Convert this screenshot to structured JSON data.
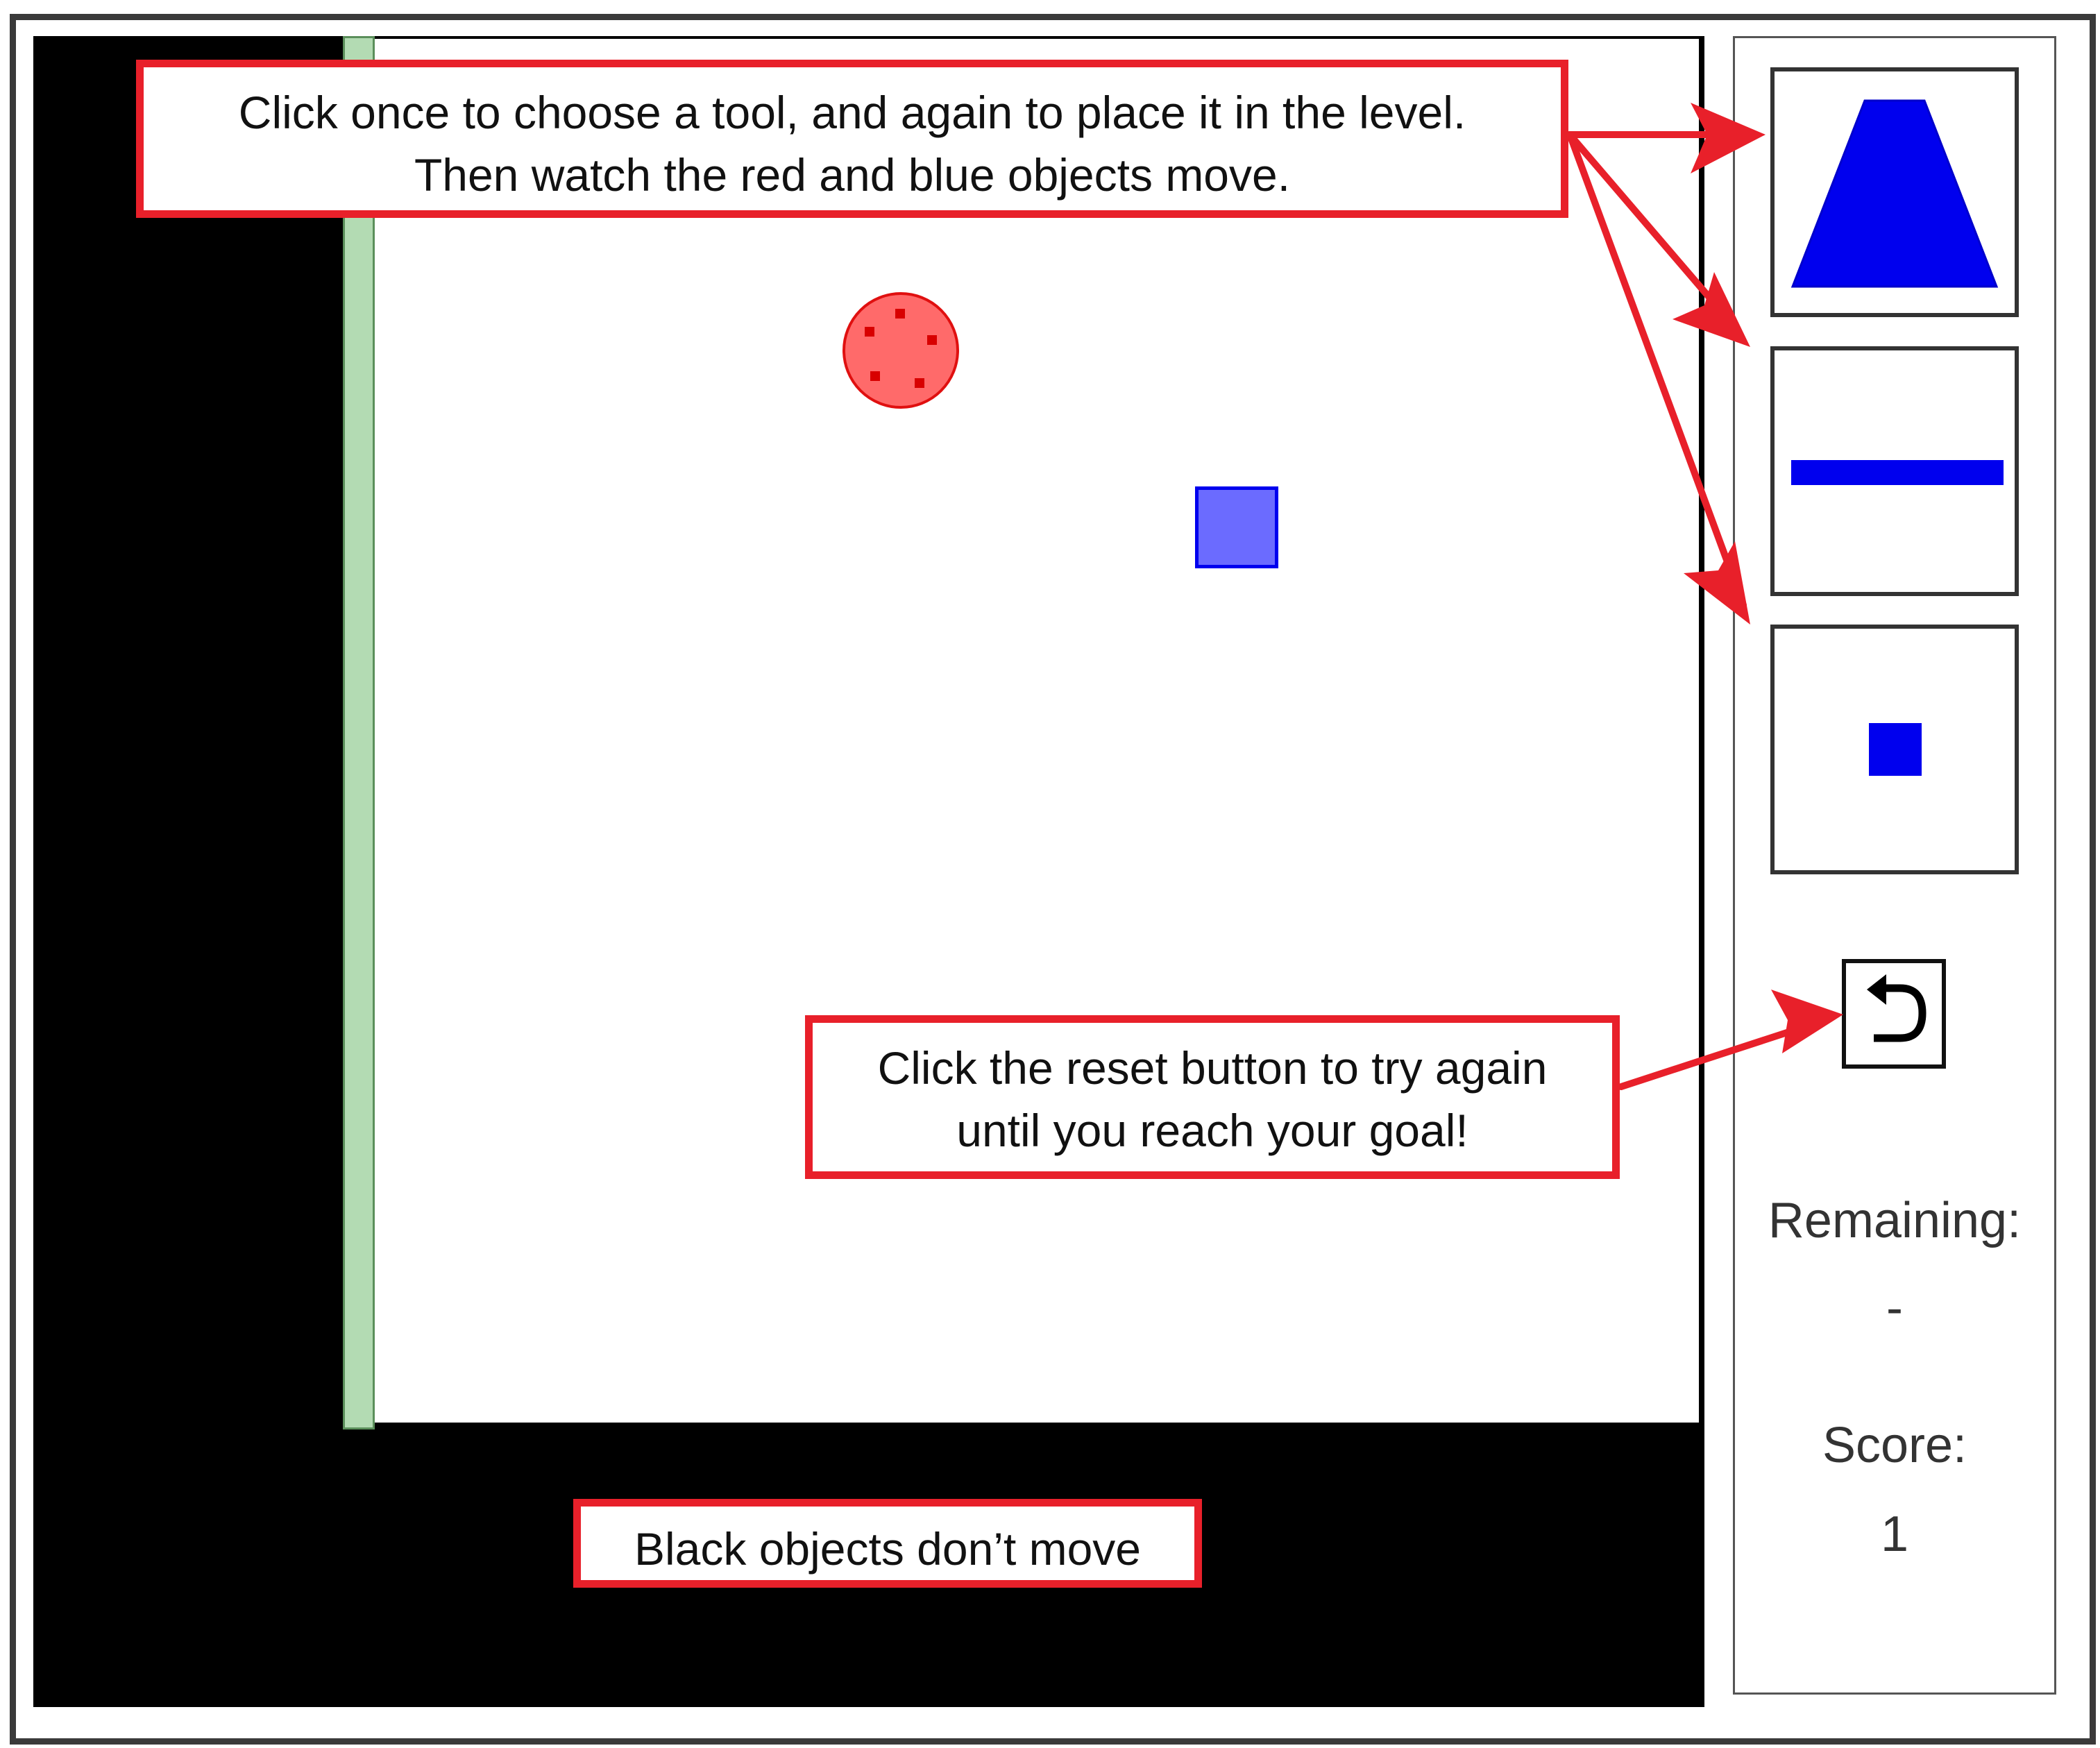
{
  "callouts": {
    "tools_line1": "Click once to choose a tool, and again to place it in the level.",
    "tools_line2": "Then watch the red and blue objects move.",
    "reset_line1": "Click the reset button to try again",
    "reset_line2": "until you reach your goal!",
    "black_objects": "Black objects don’t move"
  },
  "toolbar": {
    "tools": [
      {
        "name": "triangle-tool",
        "shape": "triangle"
      },
      {
        "name": "bar-tool",
        "shape": "bar"
      },
      {
        "name": "small-square-tool",
        "shape": "square"
      }
    ],
    "reset_icon": "undo-icon"
  },
  "stats": {
    "remaining_label": "Remaining:",
    "remaining_value": "-",
    "score_label": "Score:",
    "score_value": "1"
  },
  "colors": {
    "annotation_red": "#e8202a",
    "tool_blue": "#0000ee",
    "ball_red": "#ff6a6a",
    "goal_green": "#b3dbb3",
    "static_black": "#000000"
  }
}
